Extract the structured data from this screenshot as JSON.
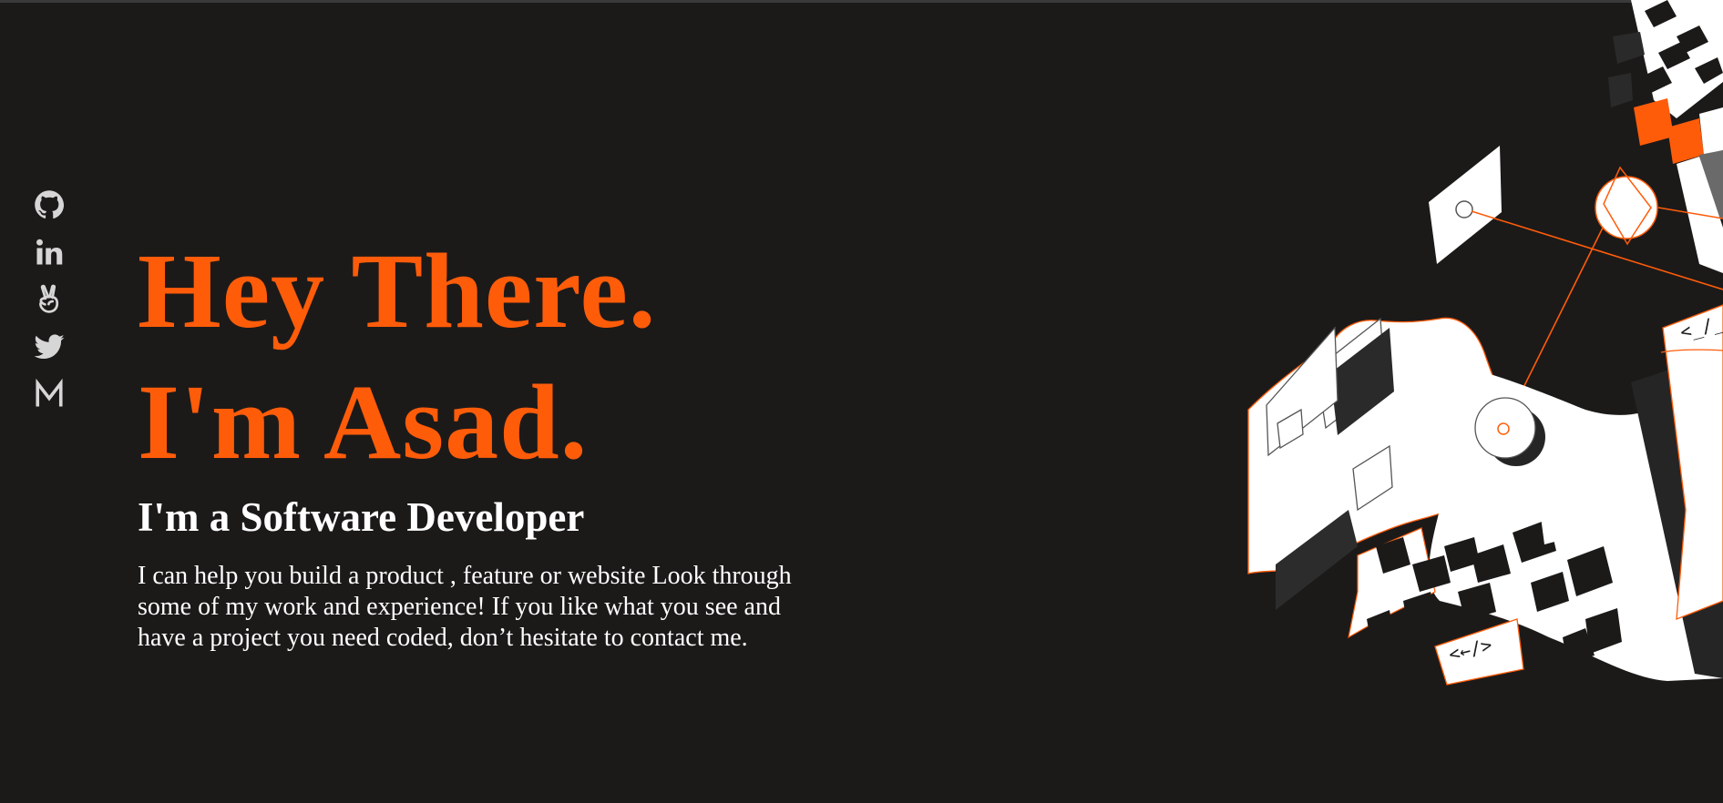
{
  "social": [
    {
      "name": "github",
      "icon": "github-icon"
    },
    {
      "name": "linkedin",
      "icon": "linkedin-icon"
    },
    {
      "name": "angellist",
      "icon": "angellist-icon"
    },
    {
      "name": "twitter",
      "icon": "twitter-icon"
    },
    {
      "name": "medium",
      "icon": "medium-icon"
    }
  ],
  "hero": {
    "line1": "Hey There.",
    "line2": "I'm Asad.",
    "subtitle": "I'm a Software Developer",
    "description": "I can help you build a product , feature or website Look through some of my work and experience! If you like what you see and have a project you need coded, don’t hesitate to contact me."
  },
  "illustration": {
    "code_tag_1": "<_/_",
    "code_tag_2": "<←/>"
  },
  "colors": {
    "background": "#1c1a19",
    "accent": "#ff5c0a",
    "text": "#ffffff",
    "icon": "#d6d6d6"
  }
}
